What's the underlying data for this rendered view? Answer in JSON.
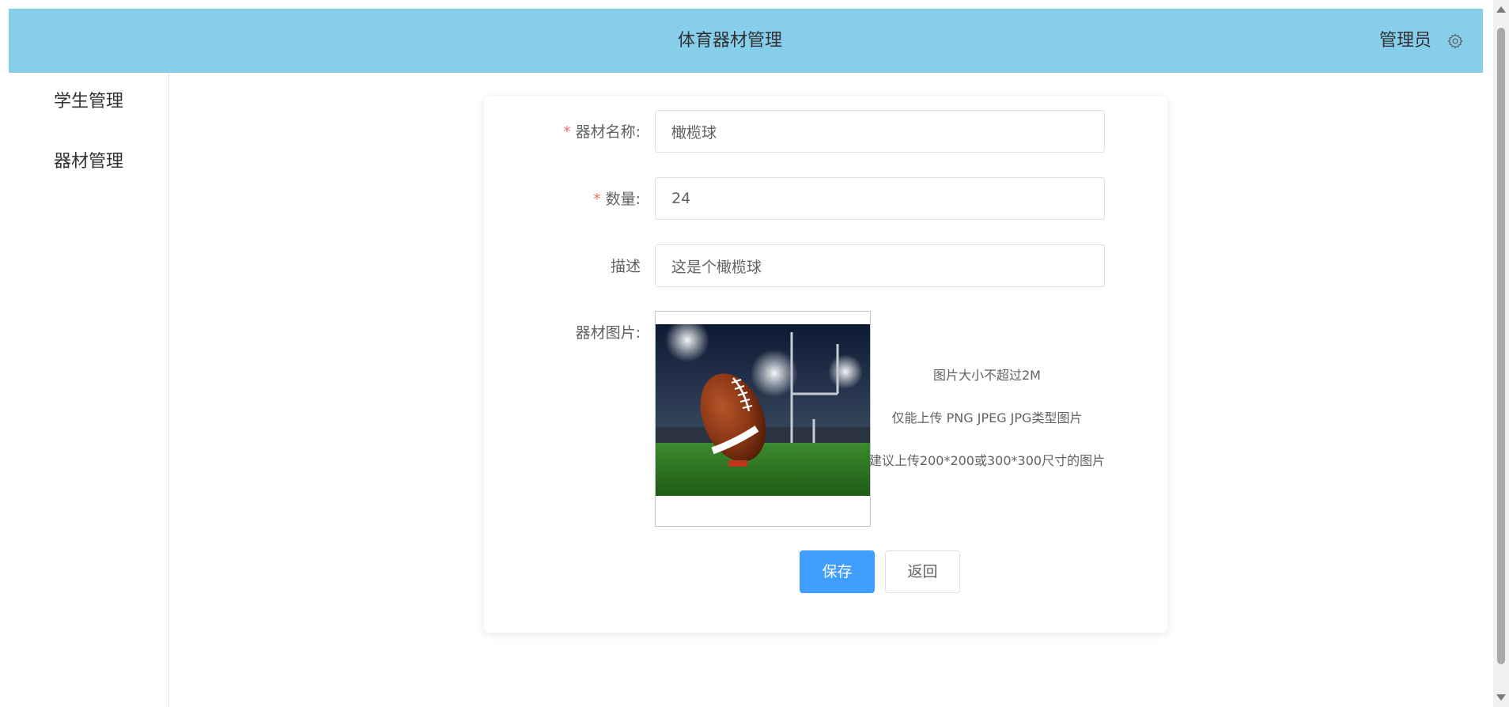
{
  "header": {
    "title": "体育器材管理",
    "user": "管理员",
    "settings_icon": "gear-icon",
    "background_color": "#87ceeb"
  },
  "sidebar": {
    "items": [
      {
        "label": "学生管理"
      },
      {
        "label": "器材管理"
      }
    ]
  },
  "form": {
    "name": {
      "label": "器材名称:",
      "value": "橄榄球",
      "required": true
    },
    "quantity": {
      "label": "数量:",
      "value": "24",
      "required": true
    },
    "description": {
      "label": "描述",
      "value": "这是个橄榄球",
      "required": false
    },
    "image": {
      "label": "器材图片:",
      "alt": "American football on a tee in a stadium",
      "hints": [
        "图片大小不超过2M",
        "仅能上传 PNG JPEG JPG类型图片",
        "建议上传200*200或300*300尺寸的图片"
      ]
    },
    "required_mark": "*",
    "save_label": "保存",
    "back_label": "返回",
    "primary_color": "#409eff",
    "required_color": "#f56c6c"
  }
}
